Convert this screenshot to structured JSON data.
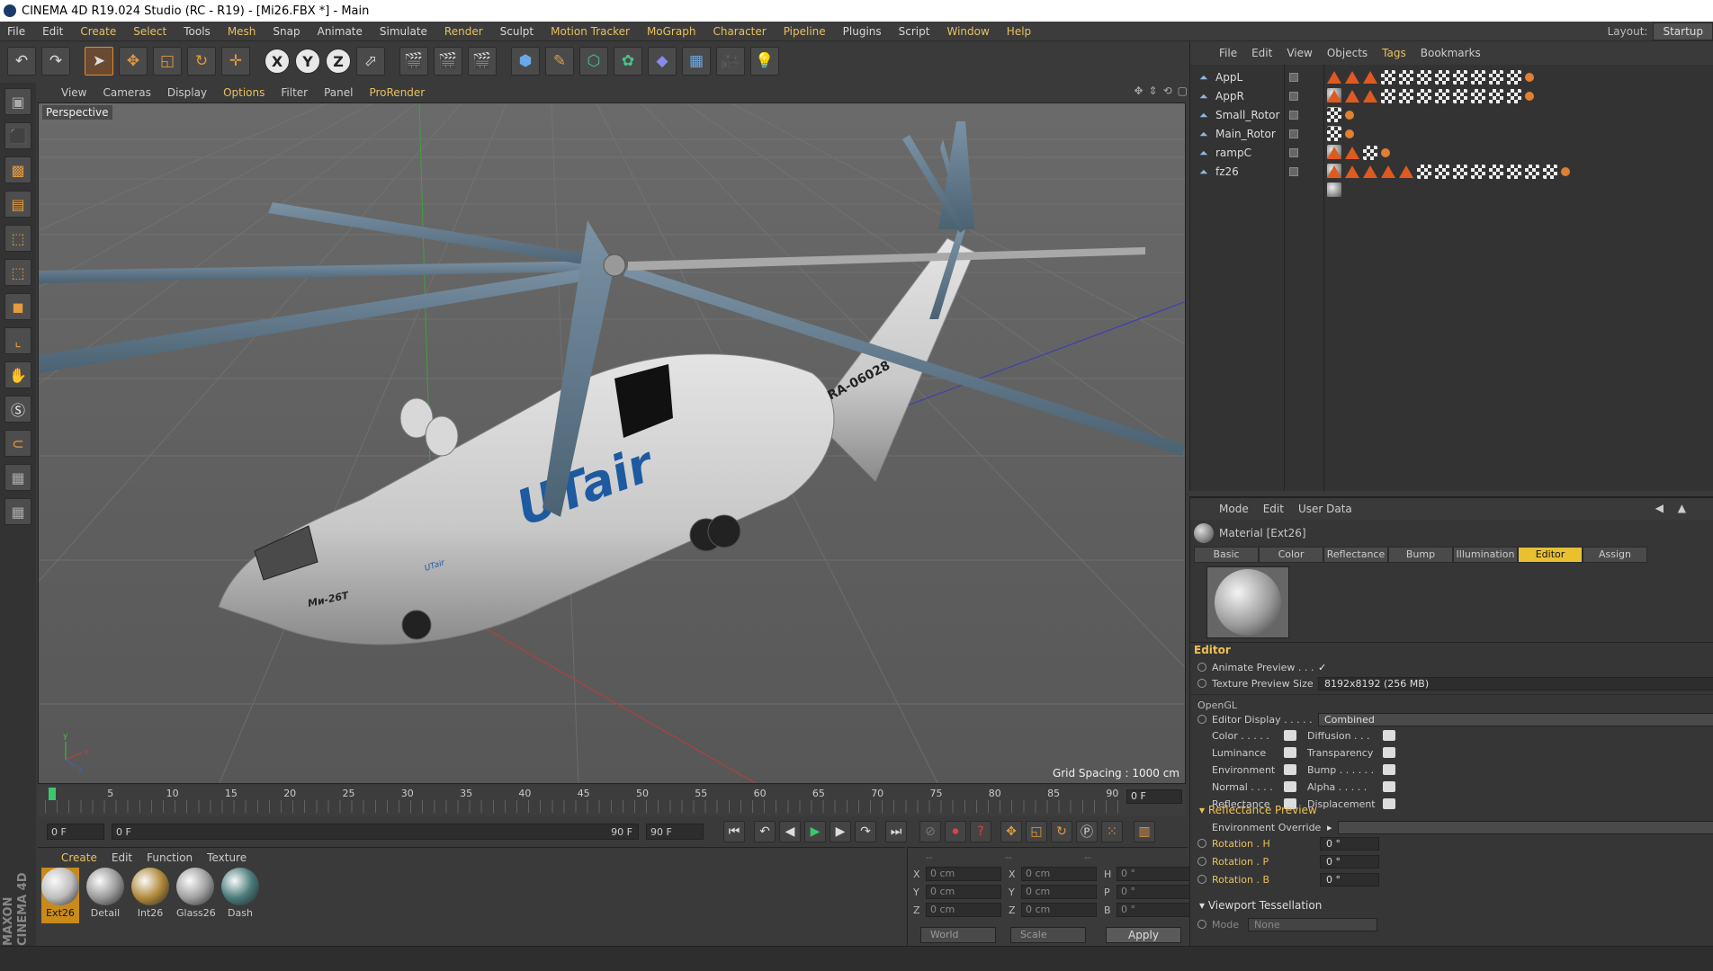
{
  "window": {
    "title": "CINEMA 4D R19.024 Studio (RC - R19) - [Mi26.FBX *] - Main"
  },
  "menubar": {
    "items": [
      {
        "label": "File",
        "hl": false
      },
      {
        "label": "Edit",
        "hl": false
      },
      {
        "label": "Create",
        "hl": true
      },
      {
        "label": "Select",
        "hl": true
      },
      {
        "label": "Tools",
        "hl": false
      },
      {
        "label": "Mesh",
        "hl": true
      },
      {
        "label": "Snap",
        "hl": false
      },
      {
        "label": "Animate",
        "hl": false
      },
      {
        "label": "Simulate",
        "hl": false
      },
      {
        "label": "Render",
        "hl": true
      },
      {
        "label": "Sculpt",
        "hl": false
      },
      {
        "label": "Motion Tracker",
        "hl": true
      },
      {
        "label": "MoGraph",
        "hl": true
      },
      {
        "label": "Character",
        "hl": true
      },
      {
        "label": "Pipeline",
        "hl": true
      },
      {
        "label": "Plugins",
        "hl": false
      },
      {
        "label": "Script",
        "hl": false
      },
      {
        "label": "Window",
        "hl": true
      },
      {
        "label": "Help",
        "hl": true
      }
    ],
    "layout_label": "Layout:",
    "layout_value": "Startup"
  },
  "toolbar": {
    "axes": [
      "X",
      "Y",
      "Z"
    ]
  },
  "viewport": {
    "menu": [
      "View",
      "Cameras",
      "Display",
      "Options",
      "Filter",
      "Panel",
      "ProRender"
    ],
    "menu_hl": [
      false,
      false,
      false,
      true,
      false,
      false,
      true
    ],
    "label": "Perspective",
    "grid_spacing": "Grid Spacing : 1000 cm",
    "axis_x": "x",
    "axis_y": "y",
    "axis_z": "z",
    "registration": "RA-06028",
    "livery_logo": "UTair",
    "livery_sub": "UTair",
    "model_name": "Ми-26Т"
  },
  "timeline": {
    "ticks": [
      "0",
      "5",
      "10",
      "15",
      "20",
      "25",
      "30",
      "35",
      "40",
      "45",
      "50",
      "55",
      "60",
      "65",
      "70",
      "75",
      "80",
      "85",
      "90"
    ],
    "current_frame": "0 F"
  },
  "transport": {
    "start": "0 F",
    "range_start": "0 F",
    "range_end": "90 F",
    "end": "90 F"
  },
  "material_manager": {
    "menu": [
      "Create",
      "Edit",
      "Function",
      "Texture"
    ],
    "materials": [
      {
        "name": "Ext26",
        "selected": true,
        "color": "#bdbdbd"
      },
      {
        "name": "Detail",
        "selected": false,
        "color": "#9a9a9a"
      },
      {
        "name": "Int26",
        "selected": false,
        "color": "#b08a3a"
      },
      {
        "name": "Glass26",
        "selected": false,
        "color": "#a0a0a0"
      },
      {
        "name": "Dash",
        "selected": false,
        "color": "#4a7a7a"
      }
    ]
  },
  "coordinates": {
    "headers": [
      "--",
      "--",
      "--"
    ],
    "rows": [
      {
        "a": "X",
        "av": "0 cm",
        "b": "X",
        "bv": "0 cm",
        "c": "H",
        "cv": "0 °"
      },
      {
        "a": "Y",
        "av": "0 cm",
        "b": "Y",
        "bv": "0 cm",
        "c": "P",
        "cv": "0 °"
      },
      {
        "a": "Z",
        "av": "0 cm",
        "b": "Z",
        "bv": "0 cm",
        "c": "B",
        "cv": "0 °"
      }
    ],
    "mode1": "World",
    "mode2": "Scale",
    "apply": "Apply"
  },
  "object_manager": {
    "menu": [
      "File",
      "Edit",
      "View",
      "Objects",
      "Tags",
      "Bookmarks"
    ],
    "menu_hl": [
      false,
      false,
      false,
      false,
      true,
      false
    ],
    "objects": [
      {
        "name": "AppL",
        "mats": 3,
        "tris": 3,
        "checks": 8
      },
      {
        "name": "AppR",
        "mats": 3,
        "tris": 3,
        "checks": 8
      },
      {
        "name": "Small_Rotor",
        "mats": 1,
        "tris": 0,
        "checks": 1
      },
      {
        "name": "Main_Rotor",
        "mats": 1,
        "tris": 0,
        "checks": 1
      },
      {
        "name": "rampC",
        "mats": 3,
        "tris": 2,
        "checks": 1
      },
      {
        "name": "fz26",
        "mats": 5,
        "tris": 5,
        "checks": 8
      }
    ]
  },
  "attributes": {
    "menu": [
      "Mode",
      "Edit",
      "User Data"
    ],
    "title": "Material [Ext26]",
    "tabs": [
      "Basic",
      "Color",
      "Reflectance",
      "Bump",
      "Illumination",
      "Editor",
      "Assign"
    ],
    "active_tab": "Editor",
    "section_editor": "Editor",
    "animate_preview": "Animate Preview . . .",
    "animate_preview_val": "✓",
    "tex_preview": "Texture Preview Size",
    "tex_preview_val": "8192x8192 (256 MB)",
    "opengl": "OpenGL",
    "editor_display": "Editor Display . . . . .",
    "editor_display_val": "Combined",
    "channels_left": [
      "Color . . . . .",
      "Luminance",
      "Environment",
      "Normal . . . .",
      "Reflectance"
    ],
    "channels_right": [
      "Diffusion . . .",
      "Transparency",
      "Bump . . . . . .",
      "Alpha . . . . .",
      "Displacement"
    ],
    "refl_preview": "Reflectance Preview",
    "env_override": "Environment Override",
    "rot_h": "Rotation . H",
    "rot_p": "Rotation . P",
    "rot_b": "Rotation . B",
    "rot_val": "0 °",
    "viewport_tess": "Viewport Tessellation",
    "mode": "Mode",
    "mode_val": "None"
  },
  "brand": "MAXON CINEMA 4D"
}
